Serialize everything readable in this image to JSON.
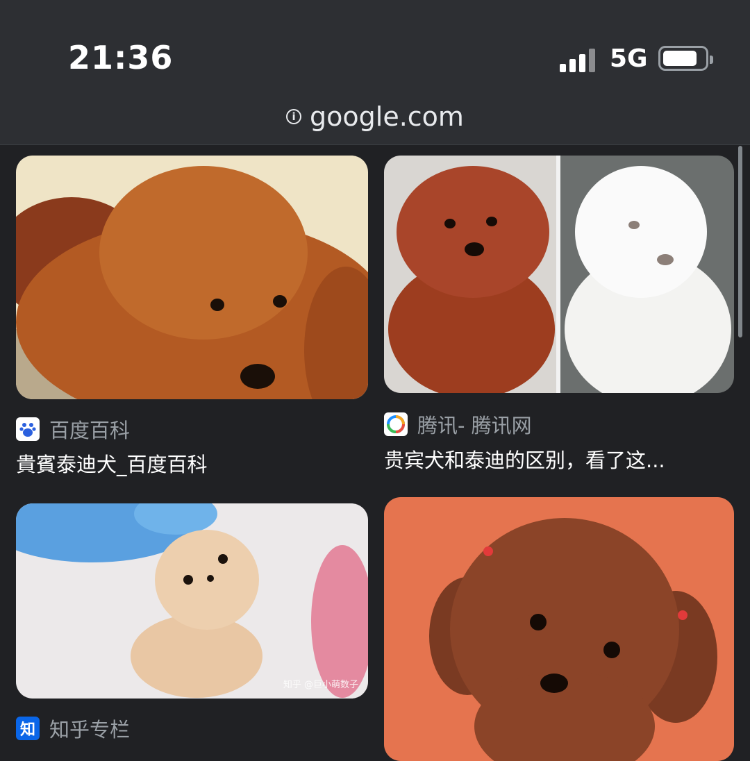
{
  "status_bar": {
    "time": "21:36",
    "network": "5G"
  },
  "browser": {
    "url": "google.com"
  },
  "results": [
    {
      "image_desc": "red-toy-poodle-lying",
      "source": "百度百科",
      "source_icon": "baidu-icon",
      "title": "貴賓泰迪犬_百度百科"
    },
    {
      "image_desc": "red-and-white-poodle",
      "source": "腾讯- 腾讯网",
      "source_icon": "tencent-news-icon",
      "title": "贵宾犬和泰迪的区别，看了这..."
    },
    {
      "image_desc": "cream-teacup-puppy",
      "source": "知乎专栏",
      "source_icon": "zhihu-icon",
      "title": "",
      "watermark": "知乎 @巨小萌数子"
    },
    {
      "image_desc": "brown-poodle-orange-bg",
      "source": "",
      "source_icon": "",
      "title": ""
    }
  ],
  "colors": {
    "background": "#202124",
    "topbar": "#2d2f33",
    "zhihu": "#0a66e8"
  }
}
